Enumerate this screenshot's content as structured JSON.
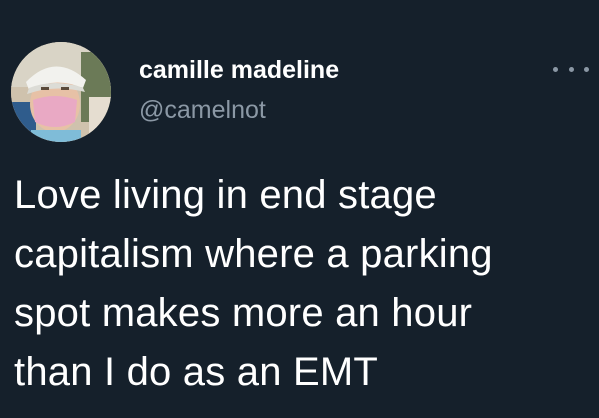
{
  "tweet": {
    "author": {
      "display_name": "camille madeline",
      "handle": "@camelnot",
      "avatar_icon": "user-avatar-photo"
    },
    "more_icon": "more-options-icon",
    "text_lines": [
      "Love living in end stage",
      "capitalism where a parking",
      "spot makes more an hour",
      "than I do as an EMT"
    ]
  },
  "colors": {
    "background": "#15202b",
    "primary_text": "#ffffff",
    "secondary_text": "#8b98a5"
  }
}
